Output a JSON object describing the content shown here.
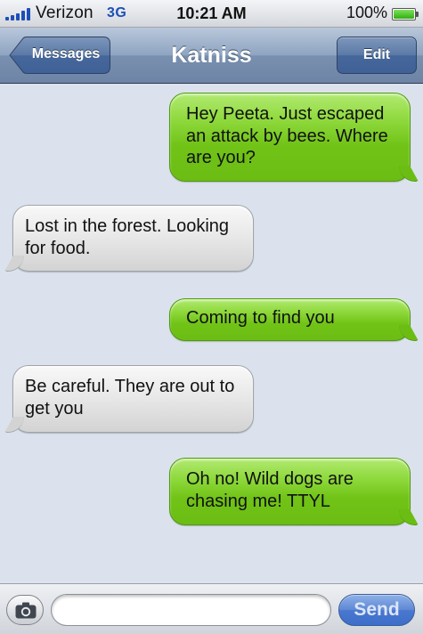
{
  "status_bar": {
    "carrier": "Verizon",
    "network": "3G",
    "time": "10:21 AM",
    "battery_percent": "100%",
    "battery_level": 1.0
  },
  "nav_bar": {
    "back_label": "Messages",
    "title": "Katniss",
    "edit_label": "Edit"
  },
  "messages": [
    {
      "direction": "outgoing",
      "text": "Hey Peeta. Just escaped an attack by bees. Where are you?"
    },
    {
      "direction": "incoming",
      "text": "Lost in the forest. Looking for food."
    },
    {
      "direction": "outgoing",
      "text": "Coming to find you"
    },
    {
      "direction": "incoming",
      "text": "Be careful. They are out to get you"
    },
    {
      "direction": "outgoing",
      "text": "Oh no! Wild dogs are chasing me! TTYL"
    }
  ],
  "input_bar": {
    "placeholder": "",
    "send_label": "Send"
  },
  "icons": {
    "signal": "signal-bars-icon",
    "battery": "battery-icon",
    "back": "back-arrow-button",
    "camera": "camera-icon"
  },
  "colors": {
    "outgoing_bubble": "#71c317",
    "incoming_bubble": "#e0e0e0",
    "nav_bar": "#7990b0",
    "send_button": "#4a78cf",
    "background": "#dbe2ed"
  }
}
